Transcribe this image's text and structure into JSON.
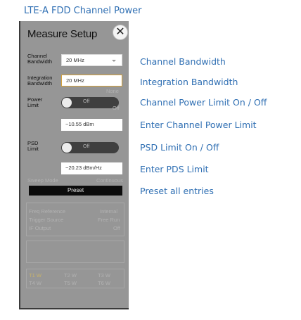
{
  "document": {
    "title": "LTE-A FDD Channel Power"
  },
  "panel": {
    "title": "Measure Setup",
    "close_glyph": "✕",
    "channel_bandwidth": {
      "label_line1": "Channel",
      "label_line2": "Bandwidth",
      "value": "20 MHz"
    },
    "integration_bandwidth": {
      "label_line1": "Integration",
      "label_line2": "Bandwidth",
      "value": "20 MHz"
    },
    "power_limit": {
      "label_line1": "Power",
      "label_line2": "Limit",
      "state": "Off",
      "value": "−10.55 dBm"
    },
    "psd_limit": {
      "label_line1": "PSD",
      "label_line2": "Limit",
      "state": "Off",
      "value": "−20.23 dBm/Hz"
    },
    "preset_label": "Preset",
    "faded_labels": [
      "Sweep Mode",
      "Continuous",
      "Freq Reference",
      "Internal",
      "Trigger Source",
      "Free Run",
      "IF Output",
      "Off",
      "T1 W",
      "T2 W",
      "T3 W",
      "T4 W",
      "T5 W",
      "T6 W",
      "None",
      "Off",
      "Off"
    ]
  },
  "callouts": [
    "Channel Bandwidth",
    "Integration Bandwidth",
    "Channel Power Limit On / Off",
    "Enter Channel Power Limit",
    "PSD Limit On / Off",
    "Enter PDS Limit",
    "Preset all entries"
  ],
  "colors": {
    "callout_text": "#2f6fb3",
    "panel_background": "#969696",
    "active_field_border": "#d4a23b",
    "preset_button": "#0c0c0c"
  }
}
